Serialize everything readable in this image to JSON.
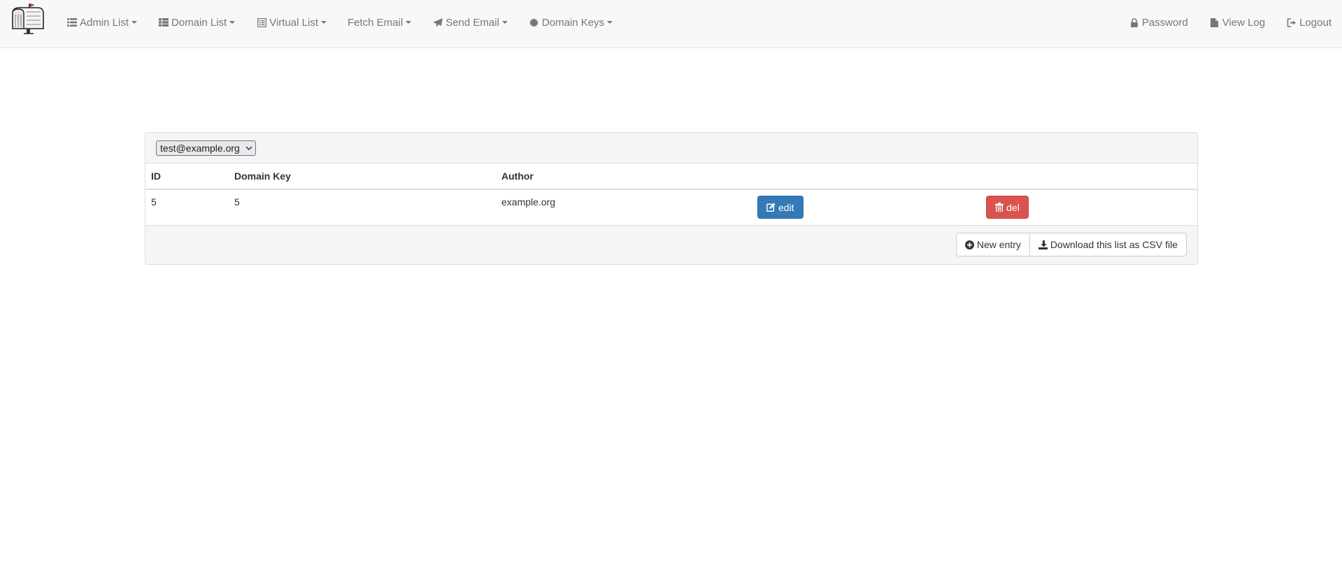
{
  "nav": {
    "left": [
      {
        "label": "Admin List",
        "icon": "list-icon"
      },
      {
        "label": "Domain List",
        "icon": "table-list-icon"
      },
      {
        "label": "Virtual List",
        "icon": "list-alt-icon"
      },
      {
        "label": "Fetch Email",
        "icon": ""
      },
      {
        "label": "Send Email",
        "icon": "send-icon"
      },
      {
        "label": "Domain Keys",
        "icon": "certificate-icon"
      }
    ],
    "right": [
      {
        "label": "Password",
        "icon": "lock-icon"
      },
      {
        "label": "View Log",
        "icon": "file-icon"
      },
      {
        "label": "Logout",
        "icon": "log-out-icon"
      }
    ]
  },
  "filter": {
    "selected": "test@example.org"
  },
  "table": {
    "columns": [
      "ID",
      "Domain Key",
      "Author"
    ],
    "rows": [
      {
        "id": "5",
        "domain_key": "5",
        "author": "example.org",
        "edit_label": "edit",
        "delete_label": "del"
      }
    ]
  },
  "footer": {
    "new_entry_label": "New entry",
    "download_label": "Download this list as CSV file"
  },
  "colors": {
    "navbar_bg": "#f8f8f8",
    "nav_text": "#777777",
    "primary": "#337ab7",
    "danger": "#d9534f",
    "panel_bg": "#f5f5f5"
  }
}
